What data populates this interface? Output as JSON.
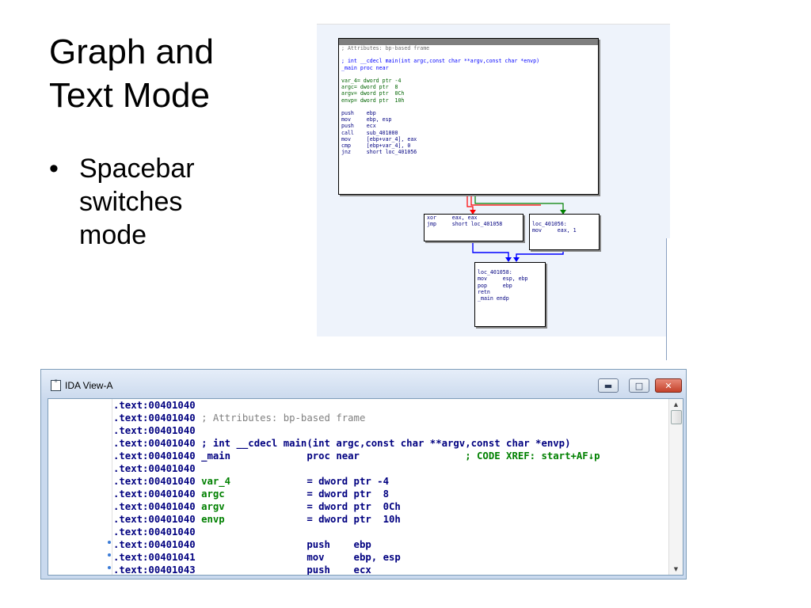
{
  "slide": {
    "title_line1": "Graph and",
    "title_line2": "Text Mode",
    "bullet_marker": "•",
    "bullet_text": "Spacebar switches mode"
  },
  "graph_view": {
    "main_node": {
      "lines": [
        {
          "text": "; Attributes: bp-based frame",
          "style": "gray"
        },
        {
          "text": "",
          "style": ""
        },
        {
          "text": "; int __cdecl main(int argc,const char **argv,const char *envp)",
          "style": "blue"
        },
        {
          "text": "_main proc near",
          "style": "blue"
        },
        {
          "text": "",
          "style": ""
        },
        {
          "text": "var_4= dword ptr -4",
          "style": "green"
        },
        {
          "text": "argc= dword ptr  8",
          "style": "green"
        },
        {
          "text": "argv= dword ptr  0Ch",
          "style": "green"
        },
        {
          "text": "envp= dword ptr  10h",
          "style": "green"
        },
        {
          "text": "",
          "style": ""
        },
        {
          "text": "push    ebp",
          "style": ""
        },
        {
          "text": "mov     ebp, esp",
          "style": ""
        },
        {
          "text": "push    ecx",
          "style": ""
        },
        {
          "text": "call    sub_401000",
          "style": ""
        },
        {
          "text": "mov     [ebp+var_4], eax",
          "style": ""
        },
        {
          "text": "cmp     [ebp+var_4], 0",
          "style": ""
        },
        {
          "text": "jnz     short loc_401056",
          "style": ""
        }
      ]
    },
    "left_node": {
      "lines": [
        {
          "text": "xor     eax, eax",
          "style": ""
        },
        {
          "text": "jmp     short loc_401058",
          "style": ""
        }
      ]
    },
    "right_node": {
      "lines": [
        {
          "text": "",
          "style": ""
        },
        {
          "text": "loc_401056:",
          "style": ""
        },
        {
          "text": "mov     eax, 1",
          "style": ""
        }
      ]
    },
    "bottom_node": {
      "lines": [
        {
          "text": "",
          "style": ""
        },
        {
          "text": "loc_401058:",
          "style": ""
        },
        {
          "text": "mov     esp, ebp",
          "style": ""
        },
        {
          "text": "pop     ebp",
          "style": ""
        },
        {
          "text": "retn",
          "style": ""
        },
        {
          "text": "_main endp",
          "style": ""
        }
      ]
    },
    "edge_colors": {
      "false_branch": "#ff0000",
      "true_branch": "#008000",
      "unconditional": "#0000ff"
    }
  },
  "ida_window": {
    "title": "IDA View-A",
    "buttons": {
      "minimize": "▬",
      "maximize": "□",
      "close": "✕"
    },
    "scroll_up": "▲",
    "scroll_down": "▼",
    "rows": [
      {
        "addr": ".text:00401040",
        "label": "",
        "op": "",
        "arg": "",
        "comment": "",
        "bp": false
      },
      {
        "addr": ".text:00401040",
        "label": "",
        "op": "",
        "arg": "",
        "comment": "; Attributes: bp-based frame",
        "bp": false
      },
      {
        "addr": ".text:00401040",
        "label": "",
        "op": "",
        "arg": "",
        "comment": "",
        "bp": false
      },
      {
        "addr": ".text:00401040",
        "label": "",
        "op": "",
        "arg": "",
        "comment": "; int __cdecl main(int argc,const char **argv,const char *envp)",
        "bp": false,
        "proto": true
      },
      {
        "addr": ".text:00401040",
        "label": "_main",
        "op": "proc near",
        "arg": "",
        "comment": "; CODE XREF: start+AF↓p",
        "bp": false
      },
      {
        "addr": ".text:00401040",
        "label": "",
        "op": "",
        "arg": "",
        "comment": "",
        "bp": false
      },
      {
        "addr": ".text:00401040",
        "label": "var_4",
        "op": "= dword ptr -4",
        "arg": "",
        "comment": "",
        "bp": false
      },
      {
        "addr": ".text:00401040",
        "label": "argc",
        "op": "= dword ptr  8",
        "arg": "",
        "comment": "",
        "bp": false
      },
      {
        "addr": ".text:00401040",
        "label": "argv",
        "op": "= dword ptr  0Ch",
        "arg": "",
        "comment": "",
        "bp": false
      },
      {
        "addr": ".text:00401040",
        "label": "envp",
        "op": "= dword ptr  10h",
        "arg": "",
        "comment": "",
        "bp": false
      },
      {
        "addr": ".text:00401040",
        "label": "",
        "op": "",
        "arg": "",
        "comment": "",
        "bp": false
      },
      {
        "addr": ".text:00401040",
        "label": "",
        "op": "push",
        "arg": "ebp",
        "comment": "",
        "bp": true
      },
      {
        "addr": ".text:00401041",
        "label": "",
        "op": "mov",
        "arg": "ebp, esp",
        "comment": "",
        "bp": true
      },
      {
        "addr": ".text:00401043",
        "label": "",
        "op": "push",
        "arg": "ecx",
        "comment": "",
        "bp": true
      }
    ]
  }
}
